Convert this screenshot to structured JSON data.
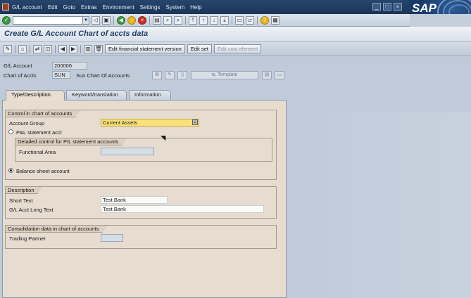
{
  "menubar": {
    "items": [
      "G/L account",
      "Edit",
      "Goto",
      "Extras",
      "Environment",
      "Settings",
      "System",
      "Help"
    ],
    "brand_text": "SAP"
  },
  "titlebar": {
    "title": "Create G/L Account Chart of accts data"
  },
  "apptoolbar": {
    "edit_fs_version": "Edit financial statement version",
    "edit_set": "Edit set",
    "edit_cost_element": "Edit cost element"
  },
  "header": {
    "gl_account_label": "G/L Account",
    "gl_account_value": "200006",
    "chart_label": "Chart of Accts",
    "chart_value": "SUN",
    "chart_desc": "Sun Chart Of Accounts",
    "template_label": "w. Template"
  },
  "tabs": [
    {
      "label": "Type/Description",
      "active": true
    },
    {
      "label": "Keyword/translation",
      "active": false
    },
    {
      "label": "Information",
      "active": false
    }
  ],
  "control_group": {
    "title": "Control in chart of accounts",
    "account_group_label": "Account Group",
    "account_group_value": "Current Assets",
    "pl_label": "P&L statement acct",
    "detail_title": "Detailed control for P/L statement accounts",
    "functional_area_label": "Functional Area",
    "functional_area_value": "",
    "balance_sheet_label": "Balance sheet account",
    "selected": "balance_sheet"
  },
  "description_group": {
    "title": "Description",
    "short_text_label": "Short Text",
    "short_text_value": "Test Bank",
    "long_text_label": "G/L Acct Long Text",
    "long_text_value": "Test Bank"
  },
  "consolidation_group": {
    "title": "Consolidation data in chart of accounts",
    "trading_partner_label": "Trading Partner",
    "trading_partner_value": ""
  },
  "colors": {
    "menubar": "#1c3458",
    "background": "#bfcbd9",
    "panel": "#e6dccf",
    "required_field": "#f7e37a",
    "title_text": "#1f3d66"
  }
}
